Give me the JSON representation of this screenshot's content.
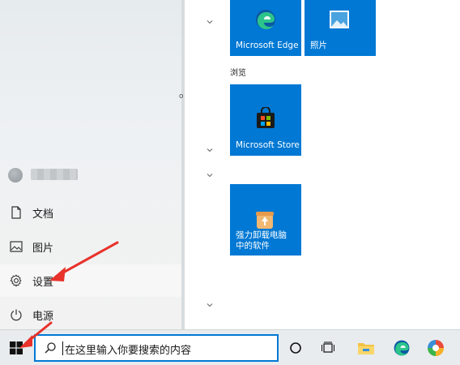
{
  "start_menu": {
    "rail": {
      "items": [
        {
          "label": "文档",
          "icon": "document-icon"
        },
        {
          "label": "图片",
          "icon": "picture-icon"
        },
        {
          "label": "设置",
          "icon": "gear-icon"
        },
        {
          "label": "电源",
          "icon": "power-icon"
        }
      ]
    },
    "group_title": "浏览",
    "tiles": [
      {
        "label": "Microsoft Edge",
        "icon": "edge-icon"
      },
      {
        "label": "照片",
        "icon": "photos-icon"
      },
      {
        "label": "Microsoft Store",
        "icon": "store-icon"
      },
      {
        "label": "强力卸载电脑中的软件",
        "icon": "uninstaller-icon"
      }
    ],
    "stray_char": "o"
  },
  "taskbar": {
    "search_placeholder": "在这里输入你要搜索的内容",
    "icons": [
      "cortana-icon",
      "task-view-icon",
      "file-explorer-icon",
      "edge-taskbar-icon",
      "colorful-app-icon"
    ]
  },
  "colors": {
    "accent": "#0078d4",
    "annotation": "#e8322b",
    "taskbar": "#e8ecef"
  }
}
